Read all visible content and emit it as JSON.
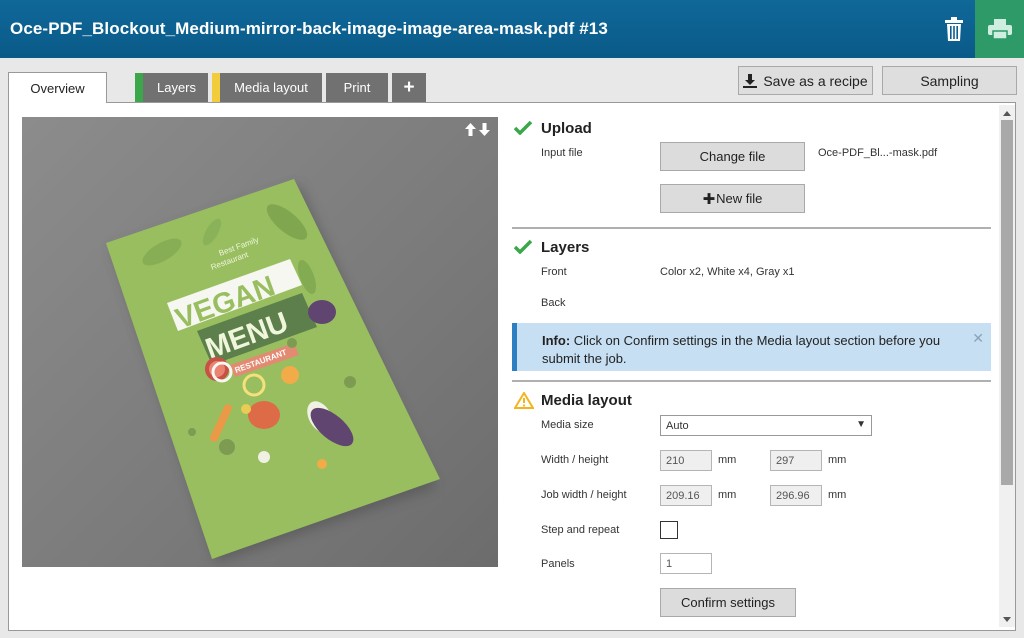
{
  "header": {
    "title": "Oce-PDF_Blockout_Medium-mirror-back-image-image-area-mask.pdf #13"
  },
  "tabs": [
    {
      "label": "Overview"
    },
    {
      "label": "Layers",
      "stripe": "#3aa84a"
    },
    {
      "label": "Media layout",
      "stripe": "#f3cc3c"
    },
    {
      "label": "Print"
    },
    {
      "label": "+"
    }
  ],
  "actions": {
    "save_recipe": "Save as a recipe",
    "sampling": "Sampling"
  },
  "upload": {
    "heading": "Upload",
    "input_label": "Input file",
    "change_button": "Change file",
    "file_name": "Oce-PDF_Bl...-mask.pdf",
    "new_button": "New file"
  },
  "layers": {
    "heading": "Layers",
    "front_label": "Front",
    "front_value": "Color x2, White x4, Gray x1",
    "back_label": "Back"
  },
  "info": {
    "prefix": "Info:",
    "message": "Click on Confirm settings in the Media layout section before you submit the job."
  },
  "media": {
    "heading": "Media layout",
    "size_label": "Media size",
    "size_value": "Auto",
    "wh_label": "Width / height",
    "width": "210",
    "height": "297",
    "unit": "mm",
    "job_label": "Job width / height",
    "job_width": "209.16",
    "job_height": "296.96",
    "step_label": "Step and repeat",
    "panels_label": "Panels",
    "panels_value": "1",
    "confirm_button": "Confirm settings"
  },
  "preview": {
    "line1": "Best Family",
    "line2": "Restaurant",
    "word1": "VEGAN",
    "word2": "MENU",
    "banner": "RESTAURANT"
  },
  "colors": {
    "header": "#0c5f8f",
    "print_button": "#2d9a68",
    "check": "#3aa84a",
    "warning": "#f3b51e",
    "info_bg": "#c6dff2"
  }
}
